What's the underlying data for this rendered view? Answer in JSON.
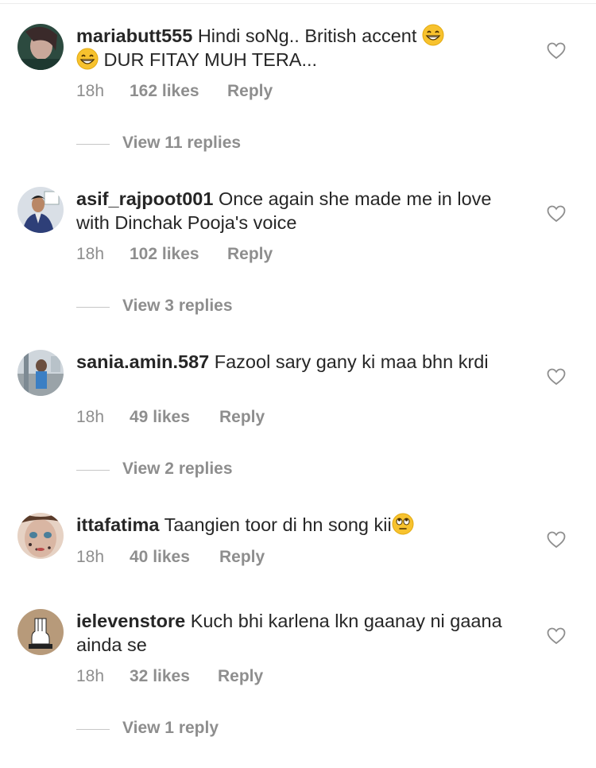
{
  "comments": [
    {
      "username": "mariabutt555",
      "text_a": "Hindi soNg.. British accent",
      "text_b": "DUR FITAY MUH TERA...",
      "time": "18h",
      "likes": "162 likes",
      "reply": "Reply",
      "view_replies": "View 11 replies",
      "emoji": "grinning-face-with-smiling-eyes"
    },
    {
      "username": "asif_rajpoot001",
      "text": "Once again she made me in love with Dinchak Pooja's voice",
      "time": "18h",
      "likes": "102 likes",
      "reply": "Reply",
      "view_replies": "View 3 replies"
    },
    {
      "username": "sania.amin.587",
      "text": "Fazool sary gany ki maa bhn krdi",
      "time": "18h",
      "likes": "49 likes",
      "reply": "Reply",
      "view_replies": "View 2 replies"
    },
    {
      "username": "ittafatima",
      "text": "Taangien toor di hn song kii",
      "time": "18h",
      "likes": "40 likes",
      "reply": "Reply",
      "emoji": "face-with-rolling-eyes"
    },
    {
      "username": "ielevenstore",
      "text": "Kuch bhi karlena lkn gaanay ni gaana ainda se",
      "time": "18h",
      "likes": "32 likes",
      "reply": "Reply",
      "view_replies": "View 1 reply"
    }
  ],
  "colors": {
    "text": "#262626",
    "secondary": "#8e8e8e",
    "divider": "#c7c7c7",
    "heart": "#8e8e8e"
  }
}
